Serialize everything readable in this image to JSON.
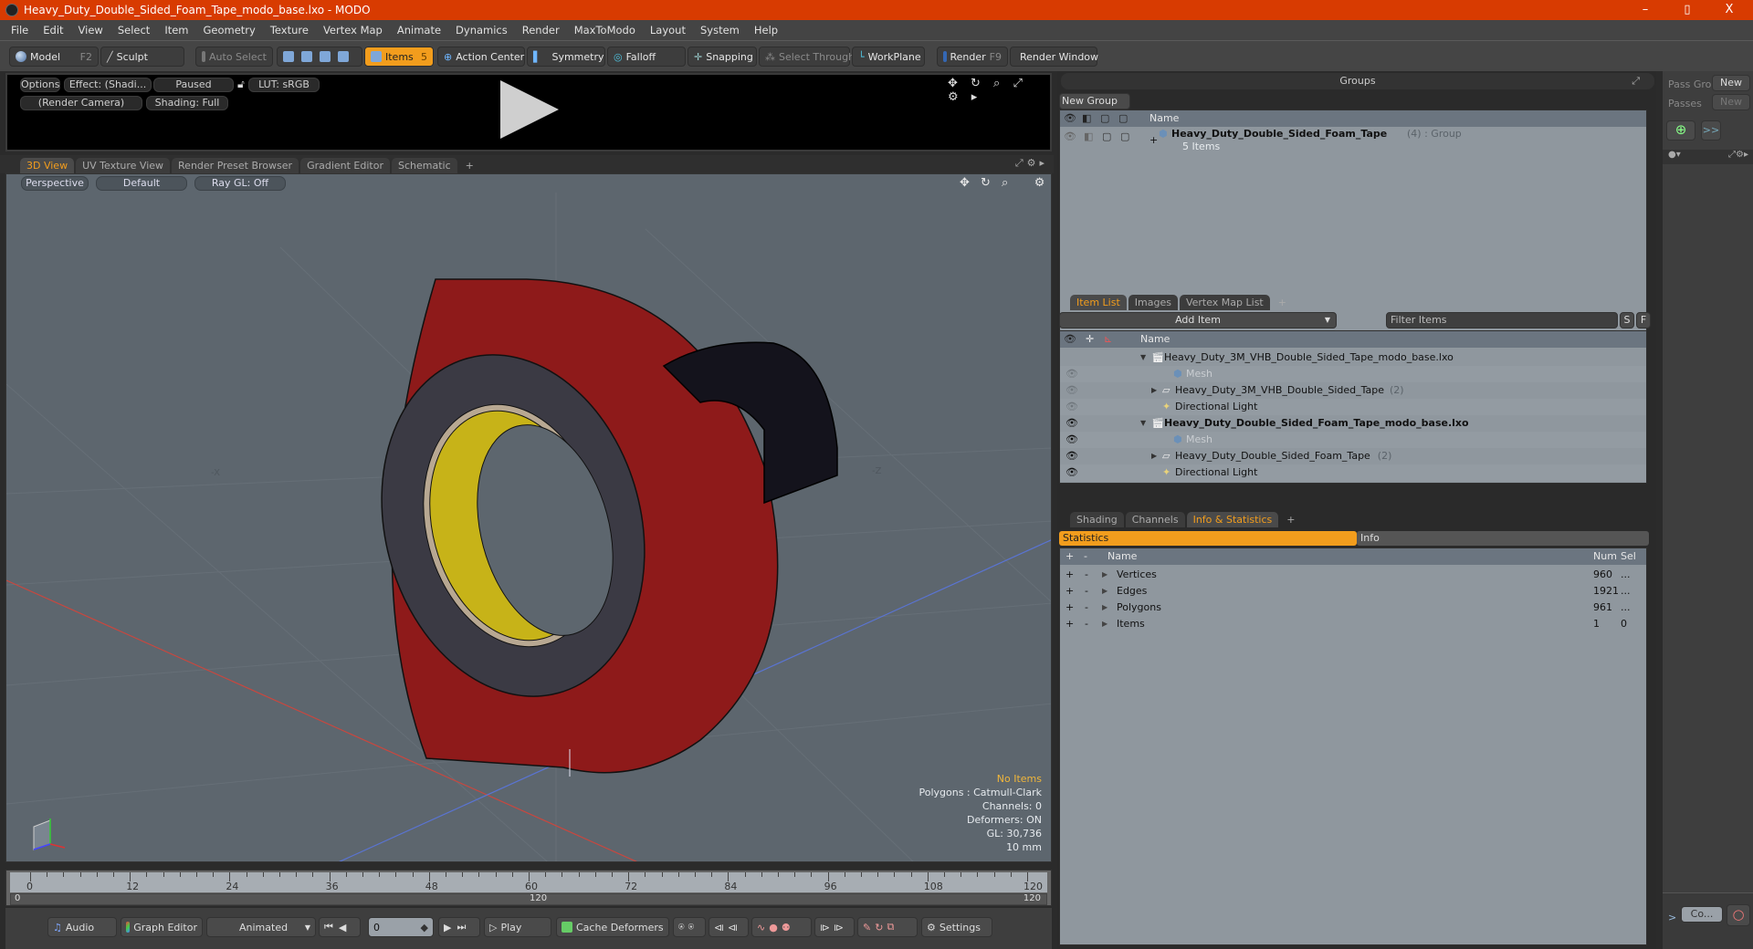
{
  "window": {
    "title": "Heavy_Duty_Double_Sided_Foam_Tape_modo_base.lxo - MODO",
    "controls": {
      "minimize": "–",
      "restore": "▯",
      "close": "X"
    }
  },
  "menu": [
    "File",
    "Edit",
    "View",
    "Select",
    "Item",
    "Geometry",
    "Texture",
    "Vertex Map",
    "Animate",
    "Dynamics",
    "Render",
    "MaxToModo",
    "Layout",
    "System",
    "Help"
  ],
  "toolbar": {
    "model": "Model",
    "model_key": "F2",
    "sculpt": "Sculpt",
    "auto_select": "Auto Select",
    "items": "Items",
    "items_key": "5",
    "action_center": "Action Center",
    "symmetry": "Symmetry",
    "falloff": "Falloff",
    "snapping": "Snapping",
    "select_through": "Select Through",
    "workplane": "WorkPlane",
    "render": "Render",
    "render_key": "F9",
    "render_window": "Render Window"
  },
  "preview": {
    "options": "Options",
    "effect": "Effect: (Shadi...",
    "paused": "Paused",
    "lut": "LUT: sRGB",
    "camera": "(Render Camera)",
    "shading": "Shading: Full",
    "icons": "✥ ↻ ⌕ ⤢ ⚙ ▸"
  },
  "view_tabs": [
    {
      "label": "3D View",
      "active": true
    },
    {
      "label": "UV Texture View",
      "active": false
    },
    {
      "label": "Render Preset Browser",
      "active": false
    },
    {
      "label": "Gradient Editor",
      "active": false
    },
    {
      "label": "Schematic",
      "active": false
    }
  ],
  "viewport": {
    "projection": "Perspective",
    "style": "Default",
    "raygl": "Ray GL: Off",
    "icons": "✥ ↻ ⌕   ⚙",
    "axis_x_label": "-X",
    "axis_z_label": "-Z",
    "hud": {
      "selection": "No Items",
      "polygons": "Polygons : Catmull-Clark",
      "channels": "Channels: 0",
      "deformers": "Deformers: ON",
      "gl": "GL: 30,736",
      "unit": "10 mm"
    },
    "colors": {
      "background": "#5d666e",
      "tape_red": "#8e1a1a",
      "tape_dark": "#3b3a44",
      "core_yellow": "#c7b318",
      "liner_black": "#14131c"
    }
  },
  "timeline": {
    "ticks": [
      "0",
      "12",
      "24",
      "36",
      "48",
      "60",
      "72",
      "84",
      "96",
      "108",
      "120"
    ],
    "range_start": "0",
    "range_mid": "120",
    "range_end": "120"
  },
  "transport": {
    "audio": "Audio",
    "graph_editor": "Graph Editor",
    "animated": "Animated",
    "frame": "0",
    "play": "Play",
    "cache_deformers": "Cache Deformers",
    "settings": "Settings"
  },
  "groups": {
    "title": "Groups",
    "new_group": "New Group",
    "col_name": "Name",
    "item_name": "Heavy_Duty_Double_Sided_Foam_Tape",
    "item_count": "(4)",
    "item_type": ": Group",
    "item_sub": "5 Items"
  },
  "passes": {
    "pass_groups": "Pass Gro",
    "passes": "Passes",
    "new1": "New",
    "new2": "New",
    "arrows": ">>"
  },
  "item_list": {
    "tabs": [
      {
        "label": "Item List",
        "active": true
      },
      {
        "label": "Images",
        "active": false
      },
      {
        "label": "Vertex Map List",
        "active": false
      }
    ],
    "add_item": "Add Item",
    "filter_placeholder": "Filter Items",
    "s_btn": "S",
    "f_btn": "F",
    "col_name": "Name",
    "rows": [
      {
        "label": "Heavy_Duty_3M_VHB_Double_Sided_Tape_modo_base.lxo",
        "count": "",
        "indent": 0,
        "expander": "▼",
        "bold": false,
        "dim": false,
        "eye": false
      },
      {
        "label": "Mesh",
        "count": "",
        "indent": 2,
        "expander": "",
        "bold": false,
        "dim": true,
        "eye": true
      },
      {
        "label": "Heavy_Duty_3M_VHB_Double_Sided_Tape",
        "count": "(2)",
        "indent": 1,
        "expander": "▶",
        "bold": false,
        "dim": false,
        "eye": true
      },
      {
        "label": "Directional Light",
        "count": "",
        "indent": 1,
        "expander": "",
        "bold": false,
        "dim": false,
        "eye": true
      },
      {
        "label": "Heavy_Duty_Double_Sided_Foam_Tape_modo_base.lxo",
        "count": "",
        "indent": 0,
        "expander": "▼",
        "bold": true,
        "dim": false,
        "eye": true
      },
      {
        "label": "Mesh",
        "count": "",
        "indent": 2,
        "expander": "",
        "bold": false,
        "dim": true,
        "eye": true
      },
      {
        "label": "Heavy_Duty_Double_Sided_Foam_Tape",
        "count": "(2)",
        "indent": 1,
        "expander": "▶",
        "bold": false,
        "dim": false,
        "eye": true
      },
      {
        "label": "Directional Light",
        "count": "",
        "indent": 1,
        "expander": "",
        "bold": false,
        "dim": false,
        "eye": true
      }
    ]
  },
  "info": {
    "tabs": [
      {
        "label": "Shading",
        "active": false
      },
      {
        "label": "Channels",
        "active": false
      },
      {
        "label": "Info & Statistics",
        "active": true
      }
    ],
    "subtabs": {
      "statistics": "Statistics",
      "info": "Info"
    },
    "cols": {
      "plus": "+",
      "minus": "-",
      "name": "Name",
      "num": "Num",
      "sel": "Sel"
    },
    "rows": [
      {
        "name": "Vertices",
        "num": "960",
        "sel": "..."
      },
      {
        "name": "Edges",
        "num": "1921",
        "sel": "..."
      },
      {
        "name": "Polygons",
        "num": "961",
        "sel": "..."
      },
      {
        "name": "Items",
        "num": "1",
        "sel": "0"
      }
    ]
  },
  "command": {
    "prompt": ">",
    "input": "Co..."
  }
}
